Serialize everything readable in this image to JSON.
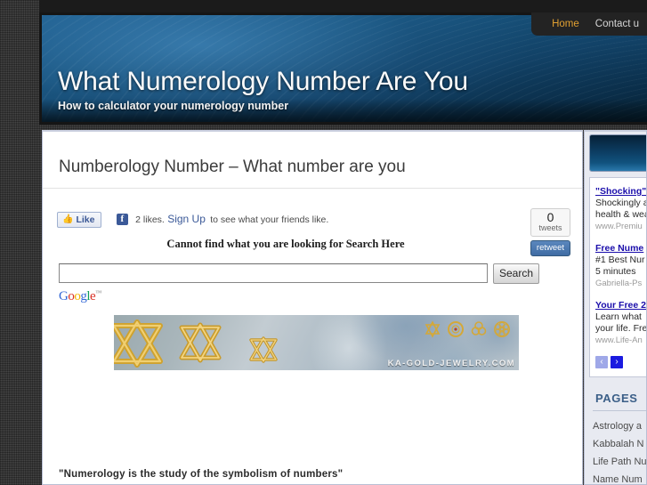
{
  "nav": {
    "items": [
      {
        "label": "Home",
        "current": true
      },
      {
        "label": "Contact u",
        "current": false
      }
    ]
  },
  "header": {
    "title": "What Numerology Number Are You",
    "tagline": "How to calculator your numerology number"
  },
  "main": {
    "post_title": "Numberology Number – What number are you",
    "facebook": {
      "like_label": "Like",
      "thumb_glyph": "👍",
      "f_glyph": "f",
      "text_before": "2 likes.",
      "signup_link": "Sign Up",
      "text_after": "to see what your friends like."
    },
    "tweet": {
      "count": "0",
      "label": "tweets",
      "button": "retweet"
    },
    "search": {
      "prompt": "Cannot find what you are looking for Search Here",
      "value": "",
      "placeholder": "",
      "button": "Search",
      "google": {
        "g1": "G",
        "o1": "o",
        "o2": "o",
        "g2": "g",
        "l": "l",
        "e": "e",
        "tm": "™"
      }
    },
    "banner_ad": {
      "credit": "KA-GOLD-JEWELRY.COM"
    },
    "quote": "\"Numerology is the study of the symbolism of numbers\""
  },
  "sidebar": {
    "ads": [
      {
        "title": "\"Shocking\"",
        "line1": "Shockingly a",
        "line2": "health & wea",
        "url": "www.Premiu"
      },
      {
        "title": "Free Nume",
        "line1": "#1 Best Nur",
        "line2": "5 minutes",
        "url": "Gabriella-Ps"
      },
      {
        "title": "Your Free 2",
        "line1": "Learn what",
        "line2": "your life. Fre",
        "url": "www.Life-An"
      }
    ],
    "ad_nav": {
      "prev": "‹",
      "next": "›"
    },
    "pages": {
      "heading": "PAGES",
      "items": [
        "Astrology a",
        "Kabbalah N",
        "Life Path Nu",
        "Name Num"
      ]
    }
  },
  "colors": {
    "accent_orange": "#e0a032",
    "header_blue": "#1e6090",
    "link_blue": "#1a0dab",
    "pages_heading": "#3b5f88"
  }
}
